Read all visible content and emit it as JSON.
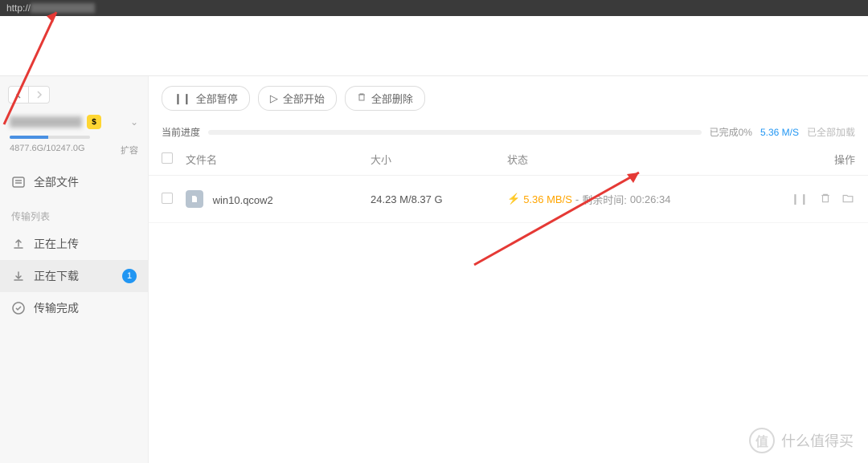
{
  "browser": {
    "url_prefix": "http://"
  },
  "sidebar": {
    "storage_text": "4877.6G/10247.0G",
    "expand_label": "扩容",
    "all_files_label": "全部文件",
    "section_title": "传输列表",
    "uploading_label": "正在上传",
    "downloading_label": "正在下载",
    "downloading_count": "1",
    "completed_label": "传输完成"
  },
  "toolbar": {
    "pause_all": "全部暂停",
    "start_all": "全部开始",
    "delete_all": "全部删除"
  },
  "progress": {
    "label": "当前进度",
    "done_text": "已完成0%",
    "speed": "5.36 M/S",
    "accel_text": "已全部加载"
  },
  "table": {
    "headers": {
      "name": "文件名",
      "size": "大小",
      "status": "状态",
      "action": "操作"
    },
    "rows": [
      {
        "filename": "win10.qcow2",
        "size": "24.23 M/8.37 G",
        "speed": "5.36 MB/S",
        "remaining_label": "剩余时间:",
        "remaining_time": "00:26:34"
      }
    ]
  },
  "watermark": {
    "text": "什么值得买",
    "logo": "值"
  }
}
